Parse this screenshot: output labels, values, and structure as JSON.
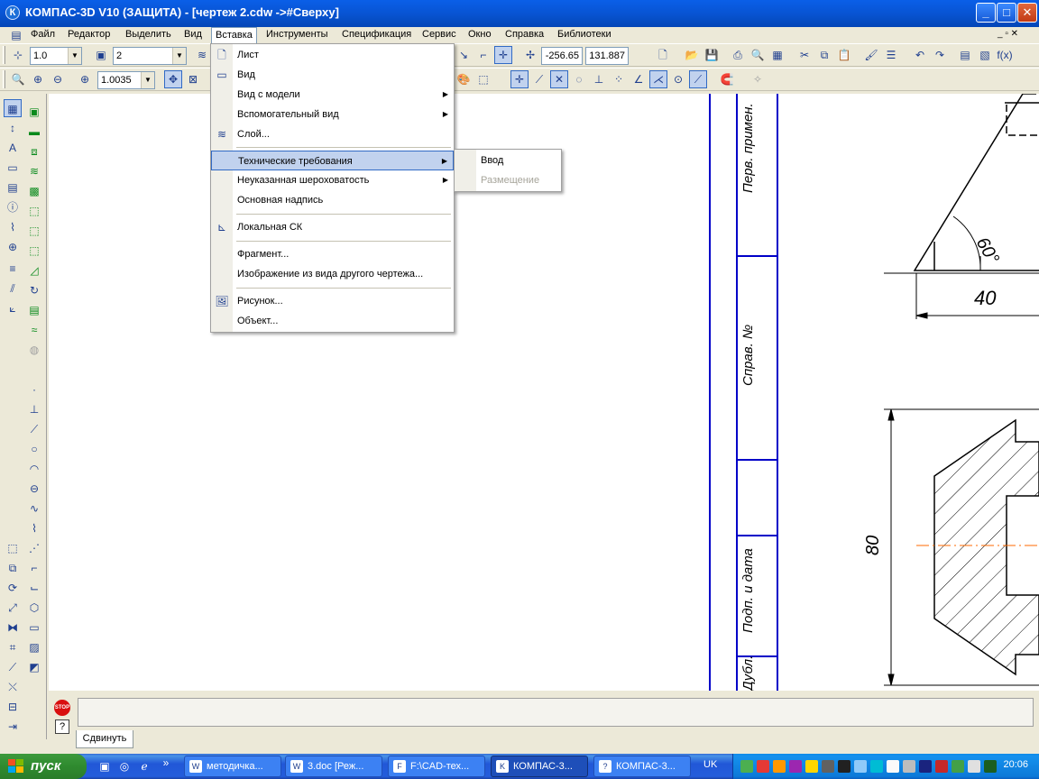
{
  "window": {
    "title": "КОМПАС-3D V10 (ЗАЩИТА) - [чертеж 2.cdw ->#Сверху]",
    "minimize_glyph": "_",
    "maximize_glyph": "□",
    "close_glyph": "✕",
    "app_icon": "К"
  },
  "menubar": {
    "items": [
      "Файл",
      "Редактор",
      "Выделить",
      "Вид",
      "Вставка",
      "Инструменты",
      "Спецификация",
      "Сервис",
      "Окно",
      "Справка",
      "Библиотеки"
    ],
    "mdi_controls": "_ ▫ ✕"
  },
  "toolbar1": {
    "scale_value": "1.0",
    "layer_value": "2",
    "coord_x": "-256.65",
    "coord_y": "131.887"
  },
  "toolbar2": {
    "zoom_value": "1.0035"
  },
  "insert_menu": {
    "items": [
      {
        "label": "Лист",
        "icon": "sheet-icon",
        "submenu": false
      },
      {
        "label": "Вид",
        "icon": "view-icon",
        "submenu": false
      },
      {
        "label": "Вид с модели",
        "icon": "",
        "submenu": true
      },
      {
        "label": "Вспомогательный вид",
        "icon": "",
        "submenu": true
      },
      {
        "label": "Слой...",
        "icon": "layers-icon",
        "submenu": false
      },
      {
        "label": "Технические требования",
        "icon": "",
        "submenu": true,
        "highlighted": true
      },
      {
        "label": "Неуказанная шероховатость",
        "icon": "",
        "submenu": true
      },
      {
        "label": "Основная надпись",
        "icon": "",
        "submenu": false
      },
      {
        "label": "Локальная СК",
        "icon": "local-cs-icon",
        "submenu": false
      },
      {
        "label": "Фрагмент...",
        "icon": "",
        "submenu": false
      },
      {
        "label": "Изображение из вида другого чертежа...",
        "icon": "",
        "submenu": false
      },
      {
        "label": "Рисунок...",
        "icon": "picture-icon",
        "submenu": false
      },
      {
        "label": "Объект...",
        "icon": "",
        "submenu": false
      }
    ]
  },
  "tech_submenu": {
    "items": [
      {
        "label": "Ввод",
        "enabled": true
      },
      {
        "label": "Размещение",
        "enabled": false
      }
    ]
  },
  "drawing": {
    "stamp_labels": [
      "Перв. примен.",
      "Справ. №",
      "Подп. и дата",
      "Дубл."
    ],
    "angle_label": "60°",
    "dim_40": "40",
    "dim_80": "80",
    "line_color": "#0000c8",
    "centerline_color": "#ff6a00"
  },
  "statusbar": {
    "stop_label": "STOP",
    "help_label": "?",
    "tab_label": "Сдвинуть"
  },
  "taskbar": {
    "start_label": "пуск",
    "buttons": [
      {
        "label": "методичка...",
        "icon": "W"
      },
      {
        "label": "3.doc [Реж...",
        "icon": "W"
      },
      {
        "label": "F:\\CAD-тех...",
        "icon": "F"
      },
      {
        "label": "КОМПАС-3...",
        "icon": "K",
        "active": true
      },
      {
        "label": "КОМПАС-3...",
        "icon": "?"
      }
    ],
    "language": "UK",
    "clock": "20:06"
  },
  "colors": {
    "titlebar": "#0854d3",
    "menu_highlight": "#c1d2ee",
    "menu_highlight_border": "#316ac5",
    "taskbar": "#245ddb",
    "start_button": "#2f8a2f"
  }
}
